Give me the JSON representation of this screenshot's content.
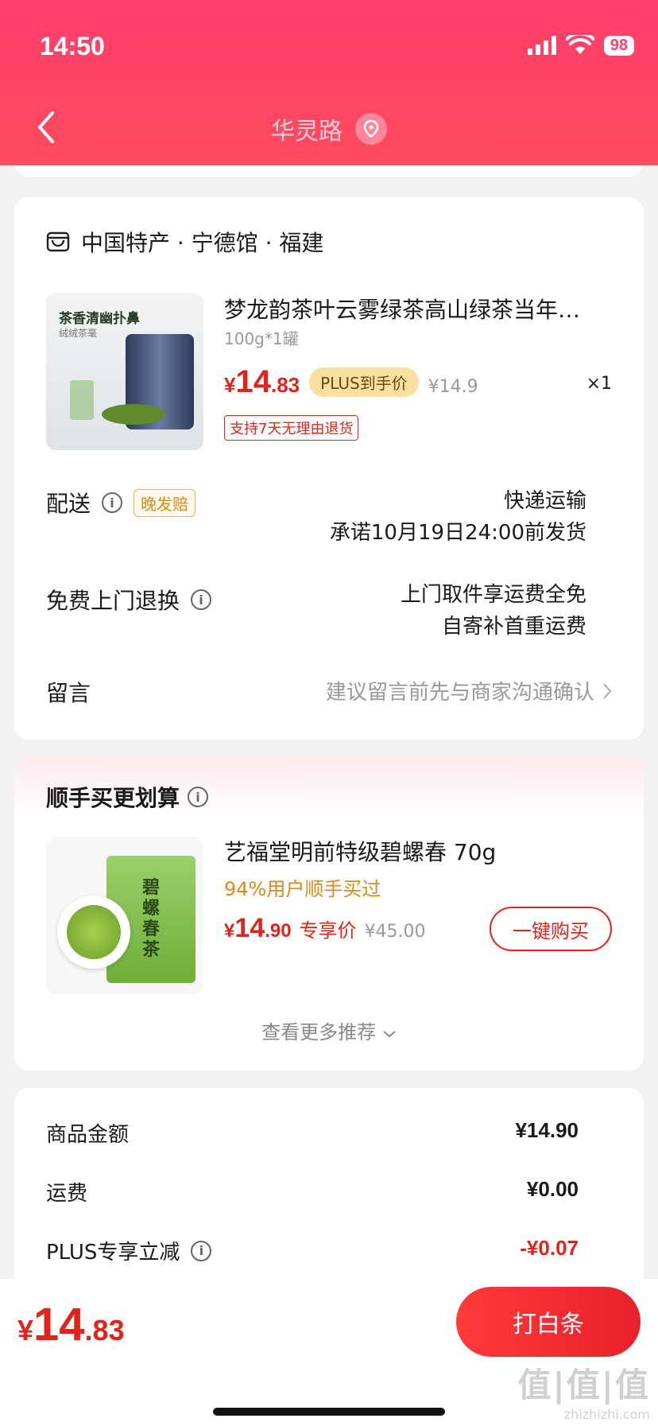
{
  "status_bar": {
    "time": "14:50",
    "battery": "98"
  },
  "nav": {
    "location": "华灵路"
  },
  "order": {
    "shop": "中国特产 · 宁德馆 · 福建",
    "product": {
      "image_caption": "茶香清幽扑鼻",
      "image_sub": "绒绒茶毫",
      "title": "梦龙韵茶叶云雾绿茶高山绿茶当年…",
      "spec": "100g*1罐",
      "price_symbol": "¥",
      "price_int": "14",
      "price_dec": ".83",
      "plus_tag": "PLUS到手价",
      "original_price": "¥14.9",
      "quantity": "×1",
      "return_tag": "支持7天无理由退货"
    },
    "delivery": {
      "label": "配送",
      "late_tag": "晚发赔",
      "method": "快递运输",
      "promise": "承诺10月19日24:00前发货"
    },
    "return_service": {
      "label": "免费上门退换",
      "line1": "上门取件享运费全免",
      "line2": "自寄补首重运费"
    },
    "note": {
      "label": "留言",
      "hint": "建议留言前先与商家沟通确认"
    }
  },
  "recommend": {
    "title": "顺手买更划算",
    "item": {
      "image_text": "碧螺春茶",
      "name": "艺福堂明前特级碧螺春 70g",
      "sub": "94%用户顺手买过",
      "price_symbol": "¥",
      "price_int": "14",
      "price_dec": ".90",
      "price_tag": "专享价",
      "original_price": "¥45.00",
      "buy_label": "一键购买"
    },
    "see_more": "查看更多推荐"
  },
  "summary": {
    "rows": [
      {
        "label": "商品金额",
        "value": "¥14.90"
      },
      {
        "label": "运费",
        "value": "¥0.00"
      },
      {
        "label": "PLUS专享立减",
        "value": "-¥0.07"
      }
    ]
  },
  "bottom": {
    "total_symbol": "¥",
    "total_int": "14",
    "total_dec": ".83",
    "pay_label": "打白条"
  },
  "watermark": {
    "big": "值|值|值",
    "small": "zhizhizhi.com"
  },
  "colors": {
    "accent": "#e2231a",
    "header": "#ff3f6c",
    "plus_gold": "#f8e0a0",
    "warning": "#d88a1a"
  }
}
